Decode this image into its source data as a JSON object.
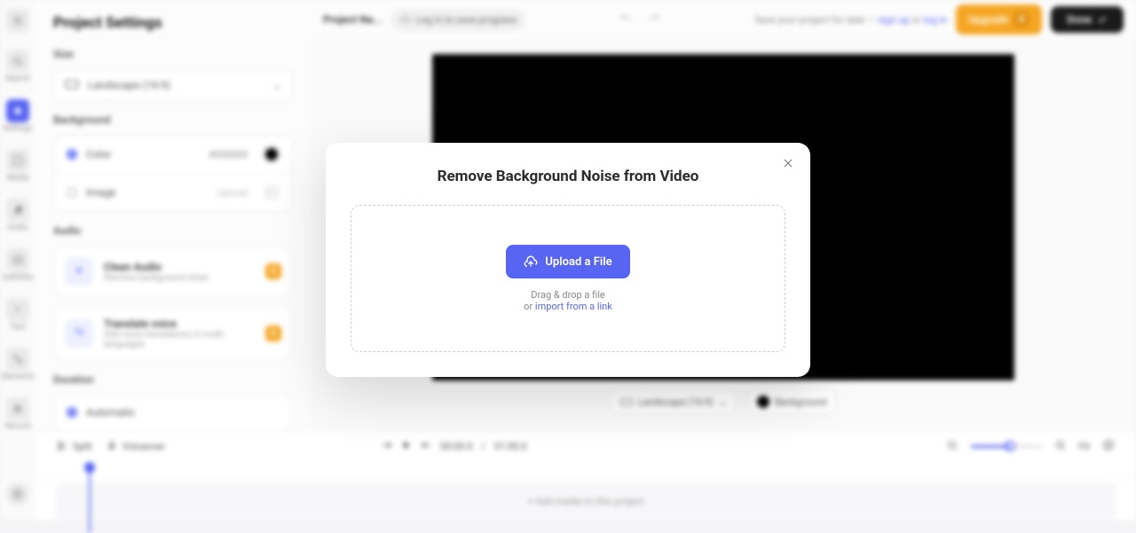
{
  "rail": {
    "items": [
      "Search",
      "Settings",
      "Media",
      "Audio",
      "Subtitles",
      "Text",
      "Elements",
      "Record"
    ]
  },
  "panel": {
    "title": "Project Settings",
    "size_label": "Size",
    "size_value": "Landscape (16:9)",
    "background_label": "Background",
    "color_label": "Color",
    "color_hex": "#000000",
    "image_label": "Image",
    "upload_label": "Upload",
    "audio_label": "Audio",
    "audio_items": [
      {
        "title": "Clean Audio",
        "sub": "Remove background noise",
        "badge": "S"
      },
      {
        "title": "Translate voice",
        "sub": "Add voice translations in multi-languages",
        "badge": "S"
      }
    ],
    "duration_label": "Duration",
    "duration_value": "Automatic"
  },
  "topbar": {
    "project_name": "Project Na...",
    "login_text": "Log in to save progress",
    "save_prefix": "Save your project for later — ",
    "signup": "sign up",
    "or": " or ",
    "login": "log in",
    "upgrade_label": "Upgrade",
    "upgrade_badge": "S",
    "done_label": "Done"
  },
  "canvas": {
    "aspect_label": "Landscape (16:9)",
    "bg_label": "Background"
  },
  "timeline": {
    "split": "Split",
    "voiceover": "Voiceover",
    "current": "00:00.0",
    "sep": "/",
    "total": "01:00.0",
    "fit": "Fit",
    "add_media": "+ Add media to this project"
  },
  "modal": {
    "title": "Remove Background Noise from Video",
    "upload_btn": "Upload a File",
    "drag_text": "Drag & drop a file",
    "or_text": "or ",
    "import_link": "import from a link"
  }
}
